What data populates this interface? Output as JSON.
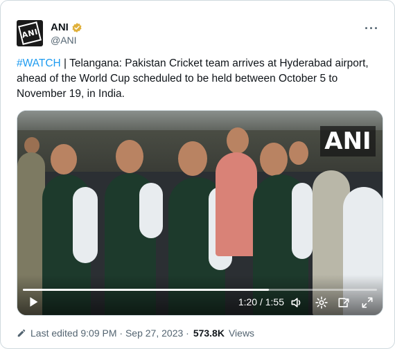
{
  "author": {
    "name": "ANI",
    "handle": "@ANI",
    "avatar_text": "ANI",
    "verified_color": "#e0b03a"
  },
  "more_label": "···",
  "tweet": {
    "hashtag": "#WATCH",
    "text": " | Telangana: Pakistan Cricket team arrives at Hyderabad airport, ahead of the World Cup scheduled to be held between October 5 to November 19, in India."
  },
  "video": {
    "watermark": "ANI",
    "current_time": "1:20",
    "duration": "1:55",
    "time_display": "1:20 / 1:55",
    "progress": 0.695
  },
  "footer": {
    "edited_text": "Last edited 9:09 PM · Sep 27, 2023 ·",
    "views_count": "573.8K",
    "views_label": "Views"
  },
  "colors": {
    "link": "#1d9bf0",
    "secondary_text": "#536471",
    "vest_green": "#1d3a2c"
  }
}
